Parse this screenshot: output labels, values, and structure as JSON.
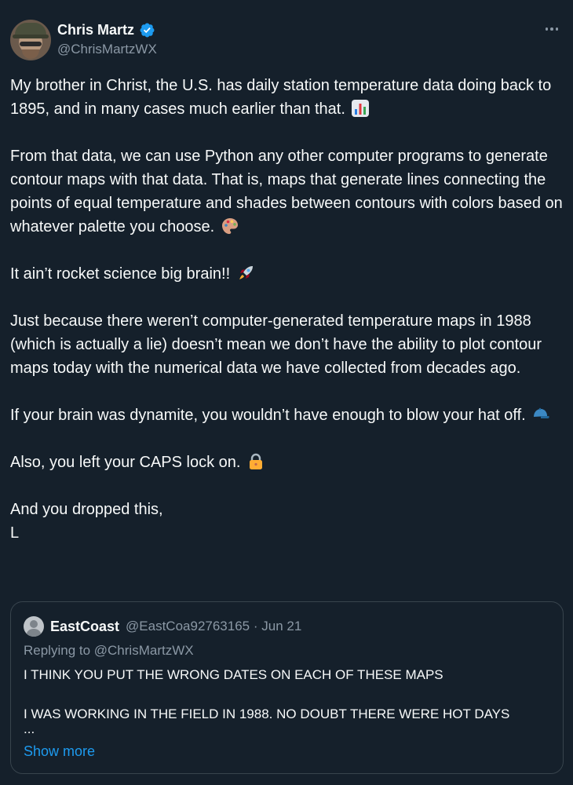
{
  "author": {
    "display_name": "Chris Martz",
    "handle": "@ChrisMartzWX",
    "verified_icon": "verified-badge-icon",
    "badge_color": "#1d9bf0"
  },
  "tweet": {
    "paragraphs": [
      "My brother in Christ, the U.S. has daily station temperature data doing back to 1895, and in many cases much earlier than that.",
      "From that data, we can use Python any other computer programs to generate contour maps with that data. That is, maps that generate lines connecting the points of equal temperature and shades between contours with colors based on whatever palette you choose.",
      "It ain’t rocket science big brain!!",
      "Just because there weren’t computer-generated temperature maps in 1988 (which is actually a lie) doesn’t mean we don’t have the ability to plot contour maps today with the numerical data we have collected from decades ago.",
      "If your brain was dynamite, you wouldn’t have enough to blow your hat off.",
      "Also, you left your CAPS lock on.",
      "And you dropped this,",
      "L"
    ],
    "emoji_icons": [
      "bar-chart-emoji-icon",
      "artist-palette-emoji-icon",
      "rocket-emoji-icon",
      "cap-emoji-icon",
      "lock-emoji-icon"
    ]
  },
  "quote": {
    "display_name": "EastCoast",
    "meta": "@EastCoa92763165 · Jun 21",
    "replying_to": "Replying to @ChrisMartzWX",
    "lines": [
      "I THINK YOU PUT THE WRONG DATES ON EACH OF THESE MAPS",
      "I WAS WORKING IN THE FIELD IN 1988. NO DOUBT THERE WERE HOT DAYS",
      "..."
    ],
    "show_more": "Show more"
  },
  "colors": {
    "background": "#15202b",
    "text": "#f7f9f9",
    "secondary": "#8b98a5",
    "link": "#1d9bf0",
    "border": "#38444d"
  }
}
